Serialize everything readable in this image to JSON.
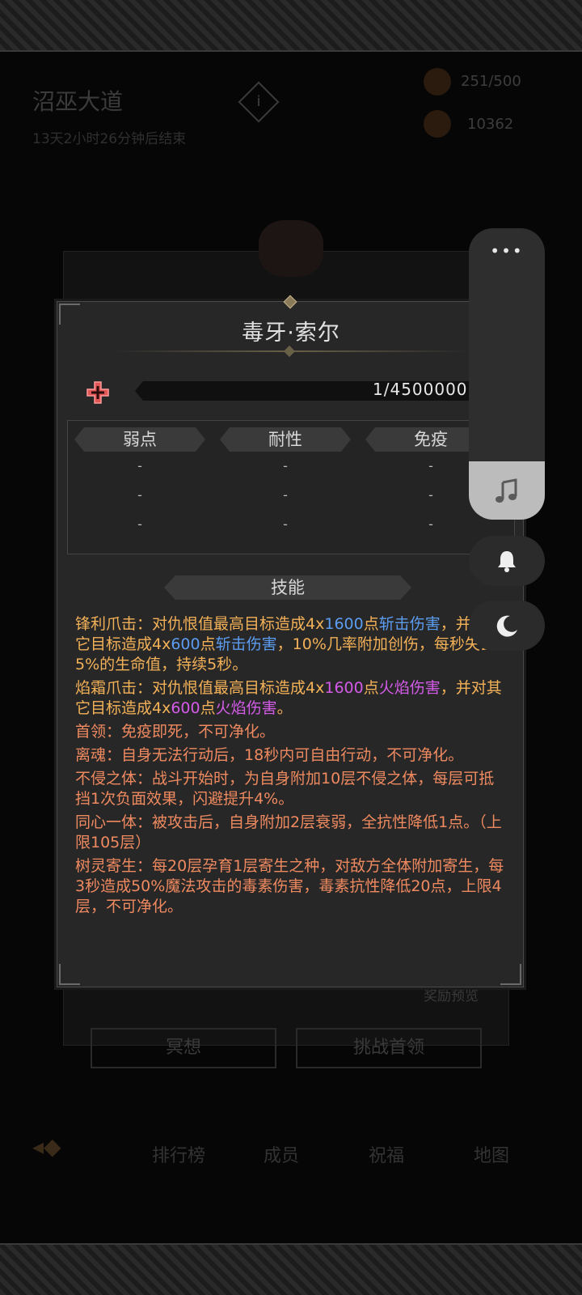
{
  "background": {
    "zone_title": "沼巫大道",
    "zone_timer": "13天2小时26分钟后结束",
    "info_glyph": "i",
    "resources": [
      {
        "icon": "torch-icon",
        "value": "251/500"
      },
      {
        "icon": "feather-icon",
        "value": "10362"
      }
    ],
    "reward_preview": "奖励预览",
    "buttons": {
      "meditate": "冥想",
      "challenge": "挑战首领"
    },
    "nav": [
      "排行榜",
      "成员",
      "祝福",
      "地图"
    ],
    "nav_back_glyph": "◂◆"
  },
  "modal": {
    "title": "毒牙·索尔",
    "hp_text": "1/4500000",
    "stats": {
      "headers": [
        "弱点",
        "耐性",
        "免疫"
      ],
      "values": [
        [
          "-",
          "-",
          "-"
        ],
        [
          "-",
          "-",
          "-"
        ],
        [
          "-",
          "-",
          "-"
        ]
      ]
    },
    "skills_header": "技能",
    "skills": [
      {
        "name": "锋利爪击：",
        "parts": [
          "对仇恨值最高目标造成4x",
          "1600",
          "点",
          "斩击伤害",
          "，并对其它目标造成4x",
          "600",
          "点",
          "斩击伤害",
          "，10%几率附加创伤，每秒失去5%的生命值，持续5秒。"
        ]
      },
      {
        "name": "焰霜爪击：",
        "parts": [
          "对仇恨值最高目标造成4x",
          "1600",
          "点",
          "火焰伤害",
          "，并对其它目标造成4x",
          "600",
          "点",
          "火焰伤害",
          "。"
        ]
      },
      {
        "name": "首领：",
        "text": "免疫即死，不可净化。"
      },
      {
        "name": "离魂：",
        "text": "自身无法行动后，18秒内可自由行动，不可净化。"
      },
      {
        "name": "不侵之体：",
        "text": "战斗开始时，为自身附加10层不侵之体，每层可抵挡1次负面效果，闪避提升4%。"
      },
      {
        "name": "同心一体：",
        "text": "被攻击后，自身附加2层衰弱，全抗性降低1点。（上限105层）"
      },
      {
        "name": "树灵寄生：",
        "text": "每20层孕育1层寄生之种，对敌方全体附加寄生，每3秒造成50%魔法攻击的毒素伤害，毒素抗性降低20点，上限4层，不可净化。"
      }
    ]
  },
  "side_widget": {
    "menu_glyph": "•••",
    "icons": [
      "music-note-icon",
      "bell-icon",
      "moon-icon"
    ]
  },
  "colors": {
    "gold": "#f3b158",
    "orange": "#ef8a60",
    "blue": "#5c9cf0",
    "purple": "#d45be8",
    "modal_bg": "#272727"
  }
}
